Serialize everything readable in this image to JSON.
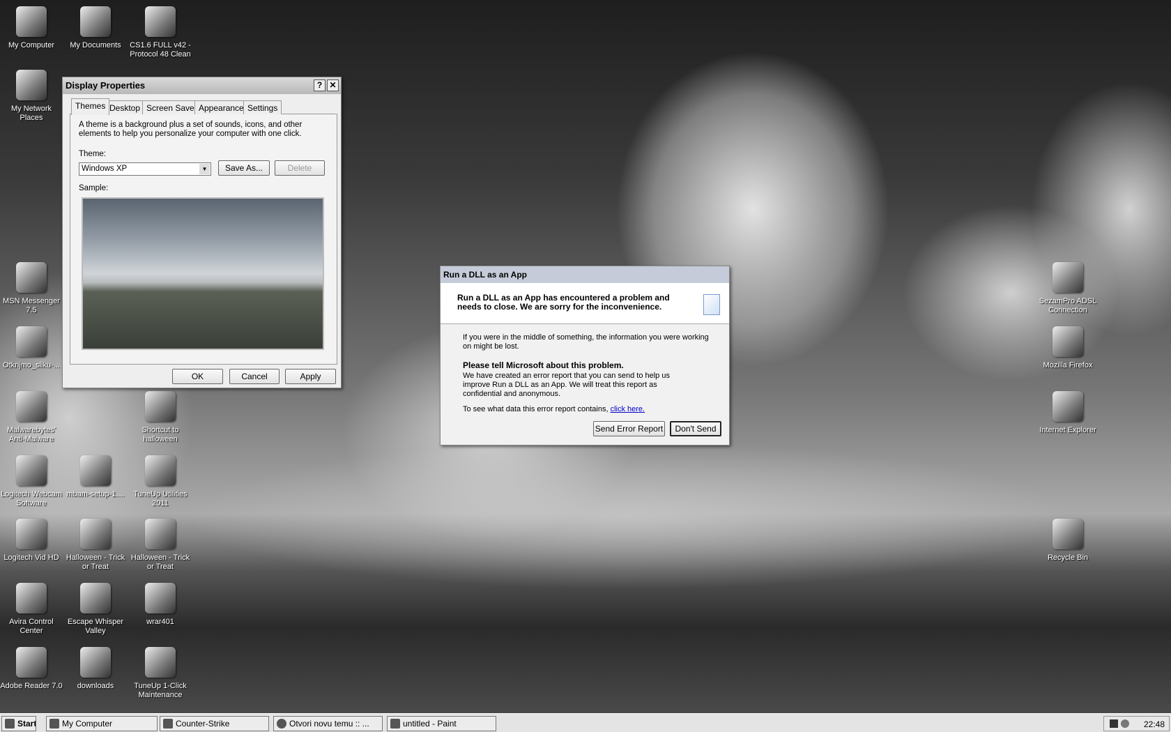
{
  "desktop_icons": [
    {
      "label": "My Computer"
    },
    {
      "label": "My Documents"
    },
    {
      "label": "CS1.6 FULL v42 - Protocol 48 Clean"
    },
    {
      "label": "My Network Places"
    },
    {
      "label": "MSN Messenger 7.5"
    },
    {
      "label": "Otkrijmo_sliku-..."
    },
    {
      "label": "Malwarebytes' Anti-Malware"
    },
    {
      "label": "Shortcut to halloween"
    },
    {
      "label": "Logitech Webcam Software"
    },
    {
      "label": "mbam-setup-1...."
    },
    {
      "label": "TuneUp Utilities 2011"
    },
    {
      "label": "Logitech Vid HD"
    },
    {
      "label": "Halloween - Trick or Treat"
    },
    {
      "label": "Halloween - Trick or Treat"
    },
    {
      "label": "Avira Control Center"
    },
    {
      "label": "Escape Whisper Valley"
    },
    {
      "label": "wrar401"
    },
    {
      "label": "Adobe Reader 7.0"
    },
    {
      "label": "downloads"
    },
    {
      "label": "TuneUp 1-Click Maintenance"
    },
    {
      "label": "SezamPro ADSL Connection"
    },
    {
      "label": "Mozilla Firefox"
    },
    {
      "label": "Internet Explorer"
    },
    {
      "label": "Recycle Bin"
    }
  ],
  "display_properties": {
    "title": "Display Properties",
    "help": "?",
    "close": "✕",
    "tabs": [
      "Themes",
      "Desktop",
      "Screen Saver",
      "Appearance",
      "Settings"
    ],
    "description": "A theme is a background plus a set of sounds, icons, and other elements to help you personalize your computer with one click.",
    "theme_label": "Theme:",
    "theme_value": "Windows XP",
    "save_as": "Save As...",
    "delete": "Delete",
    "sample_label": "Sample:",
    "ok": "OK",
    "cancel": "Cancel",
    "apply": "Apply"
  },
  "error_dialog": {
    "title": "Run a DLL as an App",
    "header": "Run a DLL as an App has encountered a problem and needs to close.  We are sorry for the inconvenience.",
    "info": "If you were in the middle of something, the information you were working on might be lost.",
    "tell_heading": "Please tell Microsoft about this problem.",
    "report_text": "We have created an error report that you can send to help us improve Run a DLL as an App.  We will treat this report as confidential and anonymous.",
    "see_data": "To see what data this error report contains,",
    "click_here": "click here.",
    "send": "Send Error Report",
    "dont_send": "Don't Send"
  },
  "taskbar": {
    "start": "Start",
    "tasks": [
      "My Computer",
      "Counter-Strike",
      "Otvori novu temu :: ...",
      "untitled - Paint"
    ],
    "clock": "22:48"
  }
}
